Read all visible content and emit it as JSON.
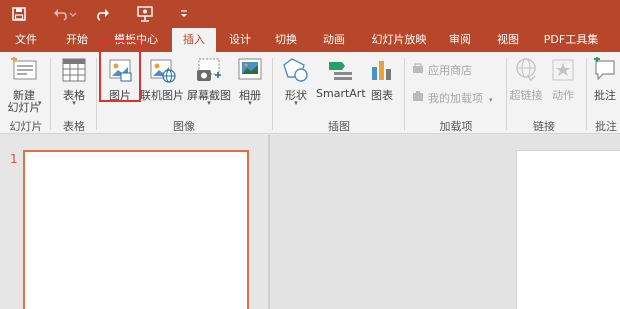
{
  "quick_access": {
    "save_icon": "save-icon",
    "undo_icon": "undo-icon",
    "redo_icon": "redo-icon",
    "presenter_icon": "presenter-icon",
    "customize_icon": "customize-icon"
  },
  "tabs": [
    {
      "label": "文件"
    },
    {
      "label": "开始"
    },
    {
      "label": "模板中心"
    },
    {
      "label": "插入",
      "active": true
    },
    {
      "label": "设计"
    },
    {
      "label": "切换"
    },
    {
      "label": "动画"
    },
    {
      "label": "幻灯片放映"
    },
    {
      "label": "审阅"
    },
    {
      "label": "视图"
    },
    {
      "label": "PDF工具集"
    }
  ],
  "ribbon": {
    "new_slide": {
      "label": "新建",
      "label2": "幻灯片"
    },
    "table": {
      "label": "表格"
    },
    "picture": {
      "label": "图片"
    },
    "online_picture": {
      "label": "联机图片"
    },
    "screenshot": {
      "label": "屏幕截图"
    },
    "album": {
      "label": "相册"
    },
    "shapes": {
      "label": "形状"
    },
    "smartart": {
      "label": "SmartArt"
    },
    "chart": {
      "label": "图表"
    },
    "store": {
      "label": "应用商店"
    },
    "my_addins": {
      "label": "我的加载项"
    },
    "hyperlink": {
      "label": "超链接"
    },
    "action": {
      "label": "动作"
    },
    "comment": {
      "label": "批注"
    },
    "groups": {
      "slides": "幻灯片",
      "tables": "表格",
      "images": "图像",
      "illustrations": "插图",
      "addins": "加载项",
      "links": "链接",
      "comments": "批注"
    }
  },
  "slides": {
    "first_number": "1"
  },
  "colors": {
    "accent": "#b7472a",
    "highlight": "#e03131",
    "selection_border": "#e07044"
  }
}
